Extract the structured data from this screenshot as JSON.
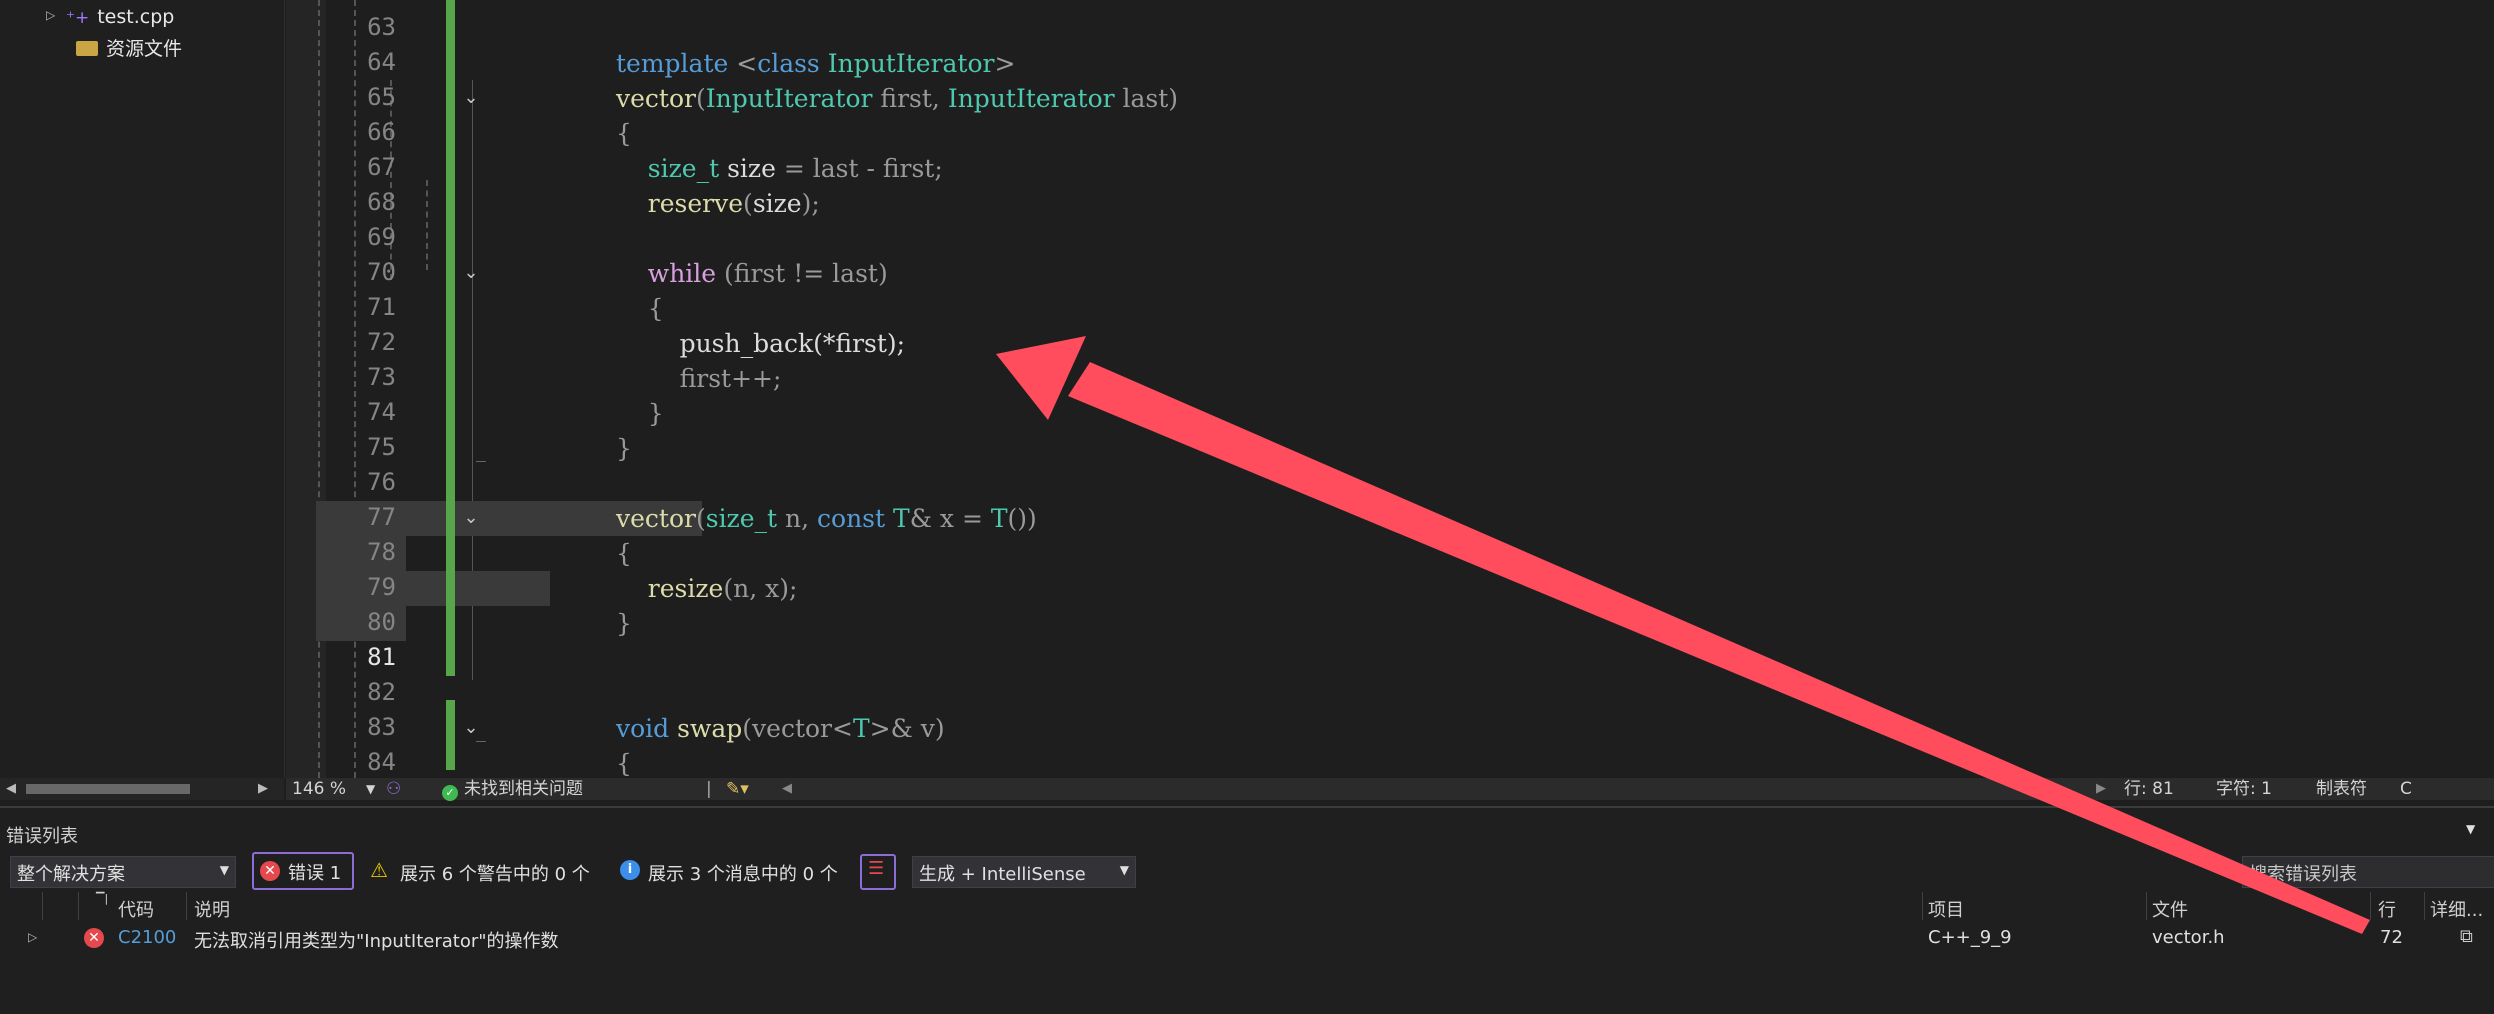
{
  "explorer": {
    "items": [
      {
        "label": "test.cpp",
        "icon": "cpp-file-icon"
      },
      {
        "label": "资源文件",
        "icon": "folder-icon"
      }
    ]
  },
  "editor": {
    "lines": [
      {
        "n": "63",
        "tokens": []
      },
      {
        "n": "64",
        "tokens": [
          [
            "kw",
            "template"
          ],
          [
            "pa",
            " <"
          ],
          [
            "kw",
            "class"
          ],
          [
            "pa",
            " "
          ],
          [
            "ty",
            "InputIterator"
          ],
          [
            "pa",
            ">"
          ]
        ]
      },
      {
        "n": "65",
        "tokens": [
          [
            "fn",
            "vector"
          ],
          [
            "pa",
            "("
          ],
          [
            "ty",
            "InputIterator"
          ],
          [
            "pa",
            " first, "
          ],
          [
            "ty",
            "InputIterator"
          ],
          [
            "pa",
            " last)"
          ]
        ]
      },
      {
        "n": "66",
        "tokens": [
          [
            "pa",
            "{"
          ]
        ]
      },
      {
        "n": "67",
        "tokens": [
          [
            "pa",
            "    "
          ],
          [
            "ty",
            "size_t"
          ],
          [
            "pa",
            " "
          ],
          [
            "tx",
            "size"
          ],
          [
            "pa",
            " = last - first;"
          ]
        ]
      },
      {
        "n": "68",
        "tokens": [
          [
            "pa",
            "    "
          ],
          [
            "fn",
            "reserve"
          ],
          [
            "pa",
            "("
          ],
          [
            "tx",
            "size"
          ],
          [
            "pa",
            ");"
          ]
        ]
      },
      {
        "n": "69",
        "tokens": []
      },
      {
        "n": "70",
        "tokens": [
          [
            "pa",
            "    "
          ],
          [
            "ctl",
            "while"
          ],
          [
            "pa",
            " (first != last)"
          ]
        ]
      },
      {
        "n": "71",
        "tokens": [
          [
            "pa",
            "    {"
          ]
        ]
      },
      {
        "n": "72",
        "tokens": [
          [
            "pa",
            "        "
          ],
          [
            "tx",
            "push_back(*first);"
          ]
        ]
      },
      {
        "n": "73",
        "tokens": [
          [
            "pa",
            "        first++;"
          ]
        ]
      },
      {
        "n": "74",
        "tokens": [
          [
            "pa",
            "    }"
          ]
        ]
      },
      {
        "n": "75",
        "tokens": [
          [
            "pa",
            "}"
          ]
        ]
      },
      {
        "n": "76",
        "tokens": []
      },
      {
        "n": "77",
        "tokens": [
          [
            "fn",
            "vector"
          ],
          [
            "pa",
            "("
          ],
          [
            "ty",
            "size_t"
          ],
          [
            "pa",
            " n, "
          ],
          [
            "kw",
            "const"
          ],
          [
            "pa",
            " "
          ],
          [
            "ty",
            "T"
          ],
          [
            "pa",
            "& x = "
          ],
          [
            "ty",
            "T"
          ],
          [
            "pa",
            "())"
          ]
        ]
      },
      {
        "n": "78",
        "tokens": [
          [
            "pa",
            "{"
          ]
        ]
      },
      {
        "n": "79",
        "tokens": [
          [
            "pa",
            "    "
          ],
          [
            "fn",
            "resize"
          ],
          [
            "pa",
            "(n, x);"
          ]
        ]
      },
      {
        "n": "80",
        "tokens": [
          [
            "pa",
            "}"
          ]
        ]
      },
      {
        "n": "81",
        "tokens": []
      },
      {
        "n": "82",
        "tokens": []
      },
      {
        "n": "83",
        "tokens": [
          [
            "kw",
            "void"
          ],
          [
            "pa",
            " "
          ],
          [
            "fn",
            "swap"
          ],
          [
            "pa",
            "(vector<"
          ],
          [
            "ty",
            "T"
          ],
          [
            "pa",
            ">& v)"
          ]
        ]
      },
      {
        "n": "84",
        "tokens": [
          [
            "pa",
            "{"
          ]
        ]
      }
    ],
    "current_line": "81"
  },
  "status": {
    "zoom": "146 %",
    "issues": "未找到相关问题",
    "line": "行: 81",
    "char": "字符: 1",
    "tabs": "制表符",
    "crlf": "C"
  },
  "error_list": {
    "title": "错误列表",
    "scope": "整个解决方案",
    "errors_btn": "错误 1",
    "warnings": "展示 6 个警告中的 0 个",
    "messages": "展示 3 个消息中的 0 个",
    "build_filter": "生成 + IntelliSense",
    "search_placeholder": "搜索错误列表",
    "columns": {
      "code": "代码",
      "desc": "说明",
      "project": "项目",
      "file": "文件",
      "line": "行",
      "detail": "详细..."
    },
    "rows": [
      {
        "code": "C2100",
        "desc": "无法取消引用类型为\"InputIterator\"的操作数",
        "project": "C++_9_9",
        "file": "vector.h",
        "line": "72"
      }
    ]
  },
  "colors": {
    "accent_arrow": "#ff4d5e",
    "change_bar": "#57a64a",
    "error_red": "#e5484d"
  }
}
